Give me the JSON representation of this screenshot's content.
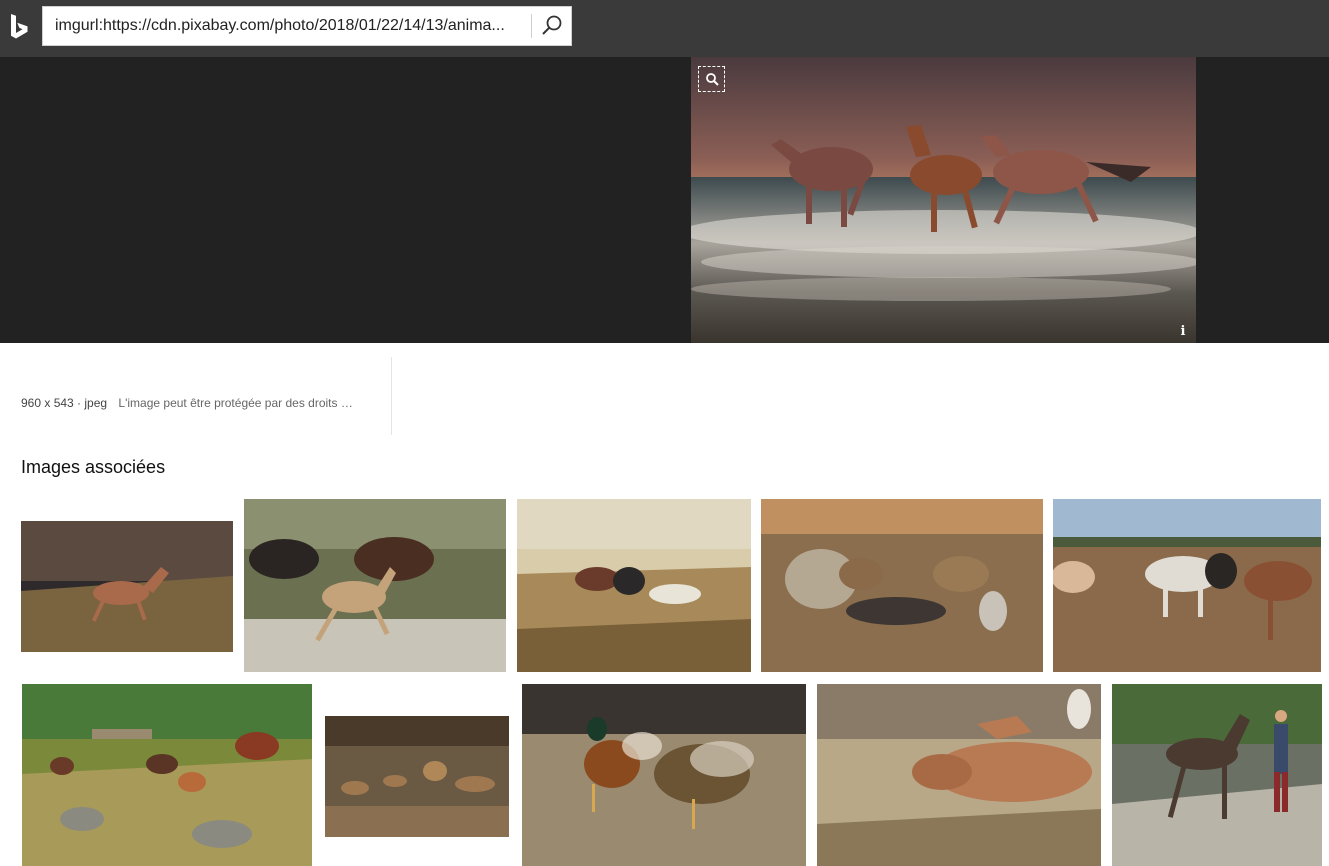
{
  "search": {
    "query": "imgurl:https://cdn.pixabay.com/photo/2018/01/22/14/13/anima..."
  },
  "main_image": {
    "icons": [
      "visual-search-icon",
      "info-icon"
    ],
    "info_label": "i"
  },
  "meta": {
    "dimensions": "960 x 543 · jpeg",
    "rights": "L'image peut être protégée par des droits …"
  },
  "related": {
    "heading": "Images associées"
  },
  "colors": {
    "topbar": "#3a3a3a",
    "viewer_bg": "#222222",
    "search_bg": "#ffffff"
  }
}
